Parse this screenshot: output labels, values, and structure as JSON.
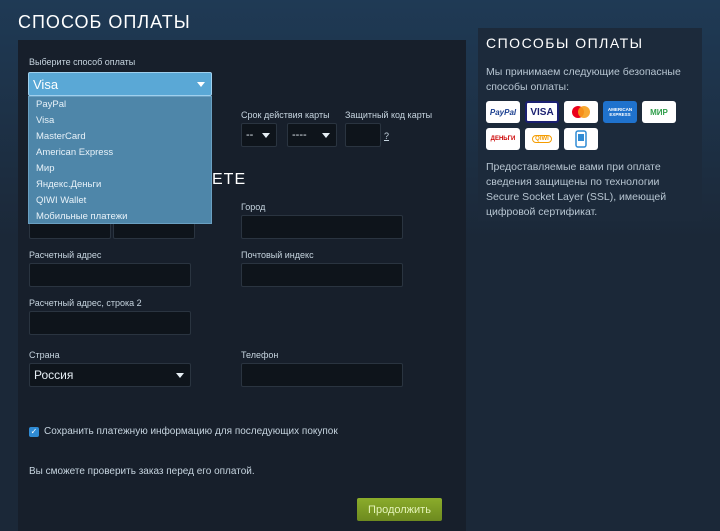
{
  "page_title": "СПОСОБ ОПЛАТЫ",
  "form": {
    "method_label": "Выберите способ оплаты",
    "method_selected": "Visa",
    "methods": [
      "PayPal",
      "Visa",
      "MasterCard",
      "American Express",
      "Мир",
      "Яндекс.Деньги",
      "QIWI Wallet",
      "Мобильные платежи"
    ],
    "expiry_label": "Срок действия карты",
    "expiry_month": "--",
    "expiry_year": "----",
    "cvv_label": "Защитный код карты",
    "cvv_help": "?",
    "section_heading_tail": "ЕТЕ",
    "city_label": "Город",
    "address_label": "Расчетный адрес",
    "postal_label": "Почтовый индекс",
    "address2_label": "Расчетный адрес, строка 2",
    "country_label": "Страна",
    "country_value": "Россия",
    "phone_label": "Телефон",
    "save_info_label": "Сохранить платежную информацию для последующих покупок",
    "save_info_checked": true,
    "review_note": "Вы сможете проверить заказ перед его оплатой.",
    "continue_label": "Продолжить"
  },
  "sidebar": {
    "title": "СПОСОБЫ ОПЛАТЫ",
    "intro": "Мы принимаем следующие безопасные способы оплаты:",
    "cards": [
      {
        "icon": "paypal-icon",
        "text": "PayPal",
        "color": "#1a3e8f"
      },
      {
        "icon": "visa-icon",
        "text": "VISA",
        "color": "#1a1f71"
      },
      {
        "icon": "mastercard-icon",
        "text": "mastercard",
        "color": "#eb001b"
      },
      {
        "icon": "amex-icon",
        "text": "AMERICAN EXPRESS",
        "color": "#1f72cd"
      },
      {
        "icon": "mir-icon",
        "text": "МИР",
        "color": "#2e9e4a"
      },
      {
        "icon": "yandex-money-icon",
        "text": "ДЕНЬГИ",
        "color": "#cc0000"
      },
      {
        "icon": "qiwi-icon",
        "text": "QIWI",
        "color": "#f59c00"
      },
      {
        "icon": "mobile-payment-icon",
        "text": "",
        "color": "#2f8bd4"
      }
    ],
    "security_note": "Предоставляемые вами при оплате сведения защищены по технологии Secure Socket Layer (SSL), имеющей цифровой сертификат."
  }
}
